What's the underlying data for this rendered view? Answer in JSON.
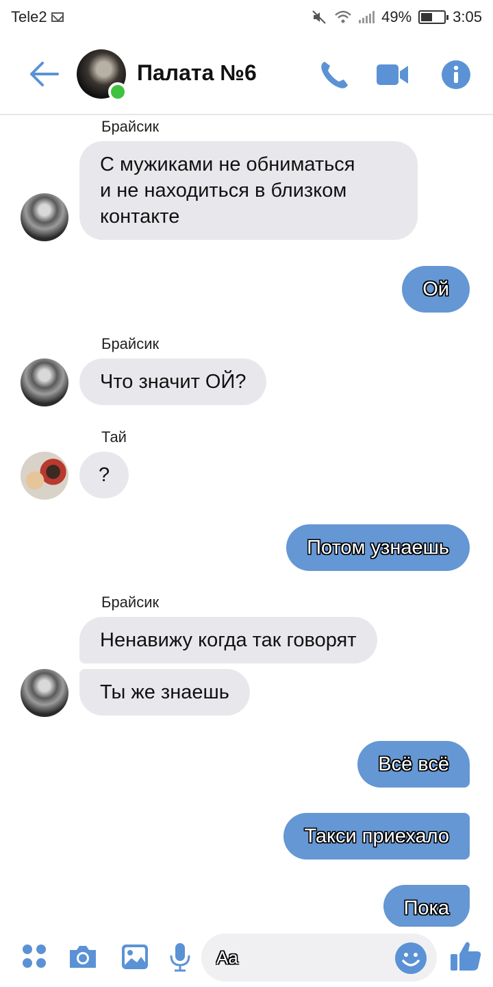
{
  "status_bar": {
    "carrier": "Tele2",
    "battery": "49%",
    "battery_level": 0.49,
    "time": "3:05"
  },
  "header": {
    "title": "Палата №6",
    "back_icon": "arrow-left-icon",
    "call_icon": "phone-icon",
    "video_icon": "video-camera-icon",
    "info_icon": "info-icon",
    "accent": "#5b92d6",
    "online_color": "#3fc23f"
  },
  "messages": [
    {
      "sender": "Брайсик",
      "direction": "in",
      "lines": [
        "С мужиками не обниматься",
        "и не находиться в близком",
        "контакте"
      ]
    },
    {
      "direction": "out",
      "text": "Ой"
    },
    {
      "sender": "Брайсик",
      "direction": "in",
      "text": "Что значит ОЙ?"
    },
    {
      "sender": "Тай",
      "direction": "in",
      "text": "?"
    },
    {
      "direction": "out",
      "text": "Потом узнаешь"
    },
    {
      "sender": "Брайсик",
      "direction": "in",
      "text": "Ненавижу когда так говорят"
    },
    {
      "direction": "in",
      "text": "Ты же знаешь"
    },
    {
      "direction": "out",
      "text": "Всё всё"
    },
    {
      "direction": "out",
      "text": "Такси приехало"
    },
    {
      "direction": "out",
      "text": "Пока"
    }
  ],
  "composer": {
    "placeholder": "Aa",
    "icons": [
      "apps-icon",
      "camera-icon",
      "gallery-icon",
      "microphone-icon",
      "emoji-icon",
      "thumbs-up-icon"
    ]
  },
  "colors": {
    "outgoing_bubble": "#6497d4",
    "incoming_bubble": "#e8e8ec"
  }
}
